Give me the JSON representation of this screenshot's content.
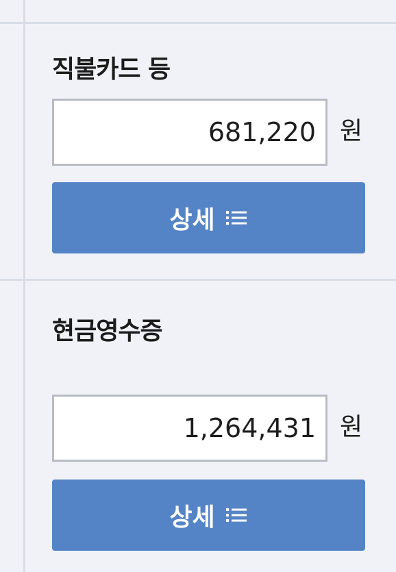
{
  "sections": [
    {
      "title": "직불카드 등",
      "amount": "681,220",
      "unit": "원",
      "button_label": "상세"
    },
    {
      "title": "현금영수증",
      "amount": "1,264,431",
      "unit": "원",
      "button_label": "상세"
    }
  ],
  "colors": {
    "background": "#f1f2f8",
    "button": "#5584c6",
    "divider": "#d8dde6",
    "input_border": "#b7bcc4"
  },
  "icons": {
    "button_icon": "list-icon"
  }
}
